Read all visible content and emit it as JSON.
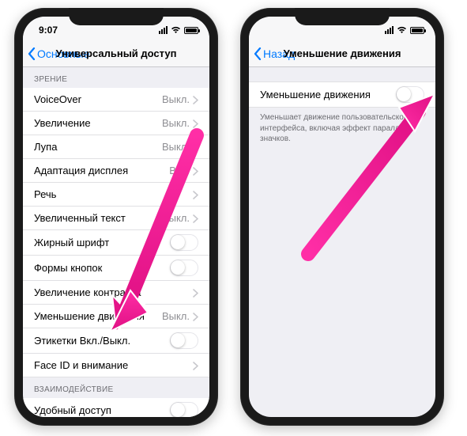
{
  "left": {
    "status": {
      "time": "9:07"
    },
    "nav": {
      "back": "Основные",
      "title": "Универсальный доступ"
    },
    "sectionVision": "ЗРЕНИЕ",
    "rows": {
      "voiceover": {
        "label": "VoiceOver",
        "value": "Выкл."
      },
      "zoom": {
        "label": "Увеличение",
        "value": "Выкл."
      },
      "magnifier": {
        "label": "Лупа",
        "value": "Выкл."
      },
      "displayAccommodations": {
        "label": "Адаптация дисплея",
        "value": "Вкл."
      },
      "speech": {
        "label": "Речь"
      },
      "largerText": {
        "label": "Увеличенный текст",
        "value": "Выкл."
      },
      "boldText": {
        "label": "Жирный шрифт"
      },
      "buttonShapes": {
        "label": "Формы кнопок"
      },
      "increaseContrast": {
        "label": "Увеличение контраста"
      },
      "reduceMotion": {
        "label": "Уменьшение движения",
        "value": "Выкл."
      },
      "onOffLabels": {
        "label": "Этикетки Вкл./Выкл."
      },
      "faceId": {
        "label": "Face ID и внимание"
      }
    },
    "sectionInteraction": "ВЗАИМОДЕЙСТВИЕ",
    "reachability": {
      "label": "Удобный доступ"
    }
  },
  "right": {
    "nav": {
      "back": "Назад",
      "title": "Уменьшение движения"
    },
    "row": {
      "label": "Уменьшение движения"
    },
    "footer": "Уменьшает движение пользовательского интерфейса, включая эффект параллакса значков."
  }
}
